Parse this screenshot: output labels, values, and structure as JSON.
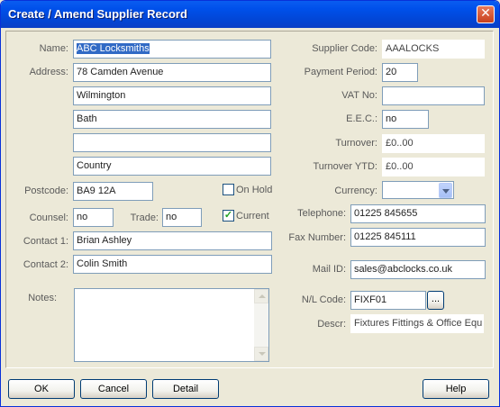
{
  "window": {
    "title": "Create / Amend Supplier Record"
  },
  "left": {
    "name_label": "Name:",
    "name_value": "ABC Locksmiths",
    "address_label": "Address:",
    "address_lines": [
      "78 Camden Avenue",
      "Wilmington",
      "Bath",
      "",
      "Country"
    ],
    "postcode_label": "Postcode:",
    "postcode_value": "BA9 12A",
    "on_hold_label": "On Hold",
    "on_hold_checked": false,
    "counsel_label": "Counsel:",
    "counsel_value": "no",
    "trade_label": "Trade:",
    "trade_value": "no",
    "current_label": "Current",
    "current_checked": true,
    "contact1_label": "Contact 1:",
    "contact1_value": "Brian Ashley",
    "contact2_label": "Contact 2:",
    "contact2_value": "Colin Smith",
    "notes_label": "Notes:",
    "notes_value": ""
  },
  "right": {
    "supplier_code_label": "Supplier Code:",
    "supplier_code_value": "AAALOCKS",
    "payment_period_label": "Payment Period:",
    "payment_period_value": "20",
    "vat_no_label": "VAT No:",
    "vat_no_value": "",
    "eec_label": "E.E.C.:",
    "eec_value": "no",
    "turnover_label": "Turnover:",
    "turnover_value": "£0..00",
    "turnover_ytd_label": "Turnover YTD:",
    "turnover_ytd_value": "£0..00",
    "currency_label": "Currency:",
    "currency_value": "",
    "telephone_label": "Telephone:",
    "telephone_value": "01225 845655",
    "fax_label": "Fax Number:",
    "fax_value": "01225 845111",
    "mail_id_label": "Mail ID:",
    "mail_id_value": "sales@abclocks.co.uk",
    "nl_code_label": "N/L Code:",
    "nl_code_value": "FIXF01",
    "nl_browse_label": "...",
    "descr_label": "Descr:",
    "descr_value": "Fixtures Fittings & Office Equi"
  },
  "buttons": {
    "ok": "OK",
    "cancel": "Cancel",
    "detail": "Detail",
    "help": "Help"
  },
  "icons": {
    "close": "close-icon",
    "checkmark": "checkmark-icon",
    "dropdown": "chevron-down-icon"
  }
}
